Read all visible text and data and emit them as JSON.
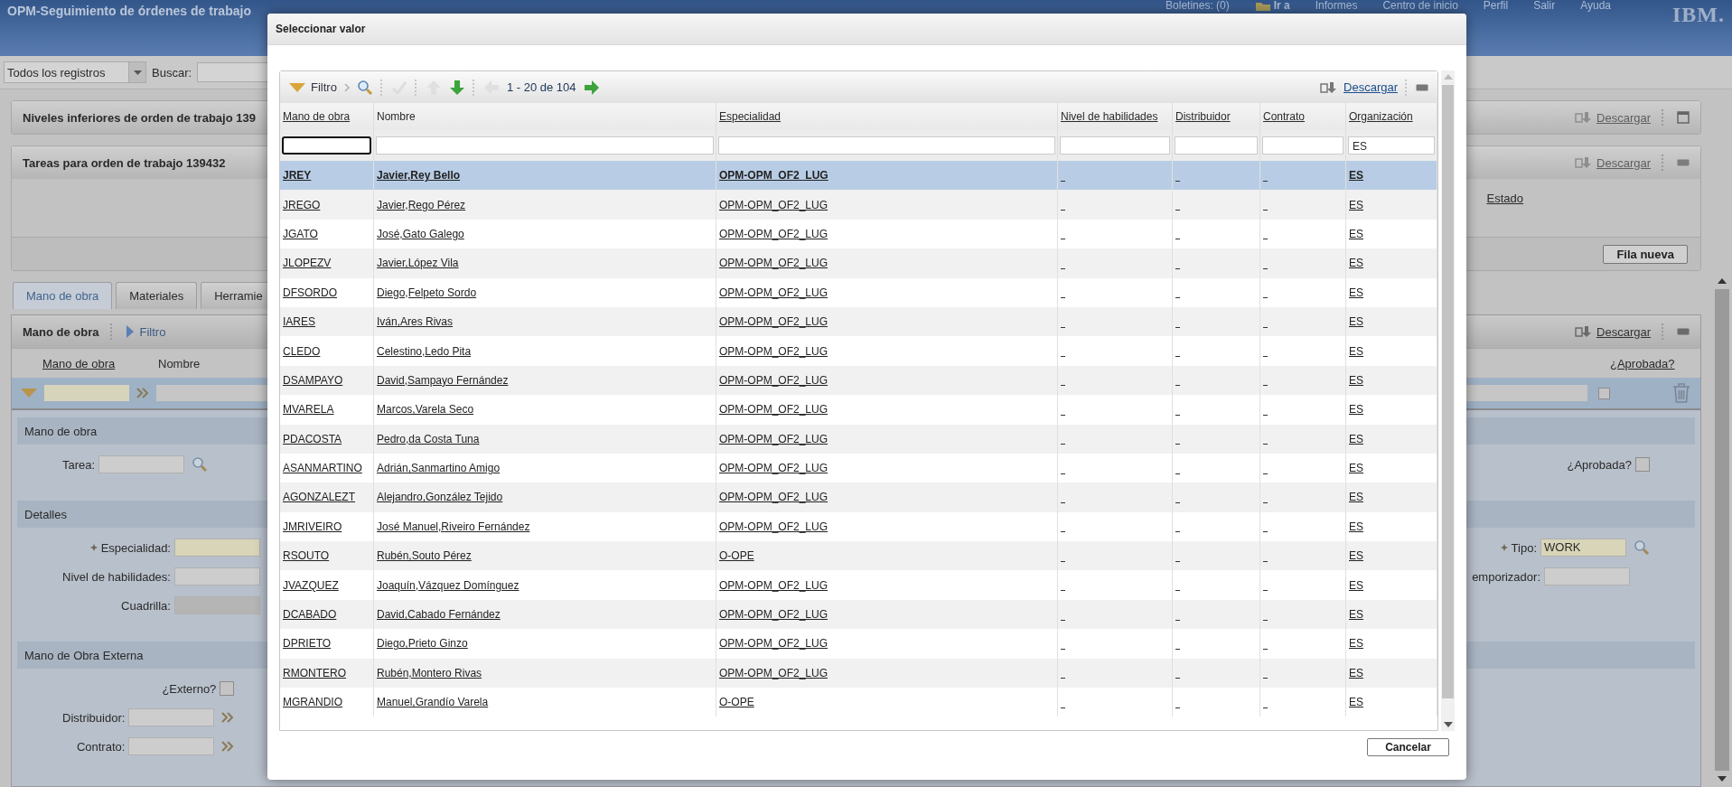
{
  "app": {
    "title": "OPM-Seguimiento de órdenes de trabajo",
    "logo": "IBM.",
    "links": [
      {
        "label": "Boletines: (0)",
        "kind": "link"
      },
      {
        "label": "Ir a",
        "kind": "menu"
      },
      {
        "label": "Informes",
        "kind": "link"
      },
      {
        "label": "Centro de inicio",
        "kind": "link"
      },
      {
        "label": "Perfil",
        "kind": "link"
      },
      {
        "label": "Salir",
        "kind": "link"
      },
      {
        "label": "Ayuda",
        "kind": "link"
      }
    ]
  },
  "toolbar": {
    "query": "Todos los registros",
    "search_label": "Buscar:"
  },
  "sections": [
    {
      "title": "Niveles inferiores de orden de trabajo 139",
      "action": "Descargar",
      "expanded": false
    },
    {
      "title": "Tareas para orden de trabajo 139432",
      "action": "Descargar",
      "expanded": true,
      "column": "Estado",
      "button": "Fila nueva"
    }
  ],
  "tabs": [
    {
      "label": "Mano de obra",
      "selected": true
    },
    {
      "label": "Materiales",
      "selected": false
    },
    {
      "label": "Herramie",
      "selected": false
    }
  ],
  "labor": {
    "title": "Mano de obra",
    "filter": "Filtro",
    "action": "Descargar",
    "approved_column": "¿Aprobada?",
    "approved": false,
    "columns": [
      {
        "label": "Mano de obra",
        "sortable": true
      },
      {
        "label": "Nombre",
        "sortable": false
      }
    ]
  },
  "form": [
    {
      "title": "Mano de obra",
      "left": [
        {
          "label": "Tarea:",
          "kind": "lookup",
          "required": false
        }
      ],
      "right": [
        {
          "label": "¿Aprobada?",
          "kind": "checkbox",
          "checked": false,
          "required": false
        }
      ]
    },
    {
      "title": "Detalles",
      "left": [
        {
          "label": "Especialidad:",
          "kind": "text",
          "required": true
        },
        {
          "label": "Nivel de habilidades:",
          "kind": "text",
          "required": false
        },
        {
          "label": "Cuadrilla:",
          "kind": "readonly",
          "required": false
        }
      ],
      "right": [
        {
          "label": "Tipo:",
          "kind": "lookup",
          "required": true,
          "value": "WORK"
        },
        {
          "label": "emporizador:",
          "kind": "text",
          "required": false
        }
      ]
    },
    {
      "title": "Mano de Obra Externa",
      "left": [
        {
          "label": "¿Externo?",
          "kind": "checkbox",
          "checked": false,
          "required": false
        },
        {
          "label": "Distribuidor:",
          "kind": "menu",
          "required": false
        },
        {
          "label": "Contrato:",
          "kind": "menu",
          "required": false
        }
      ]
    }
  ],
  "dialog": {
    "title": "Seleccionar valor",
    "filter": "Filtro",
    "paging": "1 - 20 de 104",
    "action": "Descargar",
    "cancel": "Cancelar",
    "columns": [
      {
        "label": "Mano de obra",
        "sortable": true
      },
      {
        "label": "Nombre",
        "sortable": false
      },
      {
        "label": "Especialidad",
        "sortable": true
      },
      {
        "label": "Nivel de habilidades",
        "sortable": true
      },
      {
        "label": "Distribuidor",
        "sortable": true
      },
      {
        "label": "Contrato",
        "sortable": true
      },
      {
        "label": "Organización",
        "sortable": true
      }
    ],
    "filters": [
      {
        "focused": true
      },
      {
        "focused": false
      },
      {
        "focused": false
      },
      {
        "focused": false
      },
      {
        "focused": false
      },
      {
        "focused": false
      },
      {
        "focused": false,
        "value": "ES"
      }
    ],
    "rows": [
      {
        "labor": "JREY",
        "name": "Javier,Rey Bello",
        "craft": "OPM-OPM_OF2_LUG",
        "org": "ES",
        "selected": true
      },
      {
        "labor": "JREGO",
        "name": "Javier,Rego Pérez",
        "craft": "OPM-OPM_OF2_LUG",
        "org": "ES",
        "selected": false
      },
      {
        "labor": "JGATO",
        "name": "José,Gato Galego",
        "craft": "OPM-OPM_OF2_LUG",
        "org": "ES",
        "selected": false
      },
      {
        "labor": "JLOPEZV",
        "name": "Javier,López Vila",
        "craft": "OPM-OPM_OF2_LUG",
        "org": "ES",
        "selected": false
      },
      {
        "labor": "DFSORDO",
        "name": "Diego,Felpeto Sordo",
        "craft": "OPM-OPM_OF2_LUG",
        "org": "ES",
        "selected": false
      },
      {
        "labor": "IARES",
        "name": "Iván,Ares Rivas",
        "craft": "OPM-OPM_OF2_LUG",
        "org": "ES",
        "selected": false
      },
      {
        "labor": "CLEDO",
        "name": "Celestino,Ledo Pita",
        "craft": "OPM-OPM_OF2_LUG",
        "org": "ES",
        "selected": false
      },
      {
        "labor": "DSAMPAYO",
        "name": "David,Sampayo Fernández",
        "craft": "OPM-OPM_OF2_LUG",
        "org": "ES",
        "selected": false
      },
      {
        "labor": "MVARELA",
        "name": "Marcos,Varela Seco",
        "craft": "OPM-OPM_OF2_LUG",
        "org": "ES",
        "selected": false
      },
      {
        "labor": "PDACOSTA",
        "name": "Pedro,da Costa Tuna",
        "craft": "OPM-OPM_OF2_LUG",
        "org": "ES",
        "selected": false
      },
      {
        "labor": "ASANMARTINO",
        "name": "Adrián,Sanmartino Amigo",
        "craft": "OPM-OPM_OF2_LUG",
        "org": "ES",
        "selected": false
      },
      {
        "labor": "AGONZALEZT",
        "name": "Alejandro,González Tejido",
        "craft": "OPM-OPM_OF2_LUG",
        "org": "ES",
        "selected": false
      },
      {
        "labor": "JMRIVEIRO",
        "name": "José Manuel,Riveiro Fernández",
        "craft": "OPM-OPM_OF2_LUG",
        "org": "ES",
        "selected": false
      },
      {
        "labor": "RSOUTO",
        "name": "Rubén,Souto Pérez",
        "craft": "O-OPE",
        "org": "ES",
        "selected": false
      },
      {
        "labor": "JVAZQUEZ",
        "name": "Joaquín,Vázquez Domínguez",
        "craft": "OPM-OPM_OF2_LUG",
        "org": "ES",
        "selected": false
      },
      {
        "labor": "DCABADO",
        "name": "David,Cabado Fernández",
        "craft": "OPM-OPM_OF2_LUG",
        "org": "ES",
        "selected": false
      },
      {
        "labor": "DPRIETO",
        "name": "Diego,Prieto Ginzo",
        "craft": "OPM-OPM_OF2_LUG",
        "org": "ES",
        "selected": false
      },
      {
        "labor": "RMONTERO",
        "name": "Rubén,Montero Rivas",
        "craft": "OPM-OPM_OF2_LUG",
        "org": "ES",
        "selected": false
      },
      {
        "labor": "MGRANDIO",
        "name": "Manuel,Grandío Varela",
        "craft": "O-OPE",
        "org": "ES",
        "selected": false
      }
    ]
  }
}
